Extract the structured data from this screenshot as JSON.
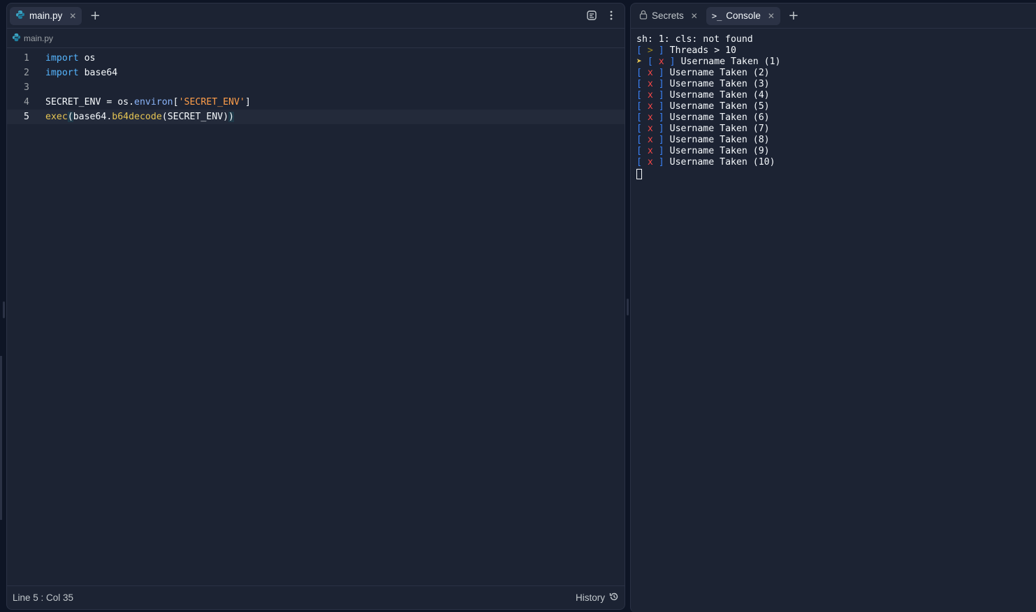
{
  "editor": {
    "tabs": [
      {
        "label": "main.py",
        "icon": "python-icon",
        "active": true
      }
    ],
    "add_tab_label": "+",
    "breadcrumb": "main.py",
    "lines": [
      {
        "n": "1",
        "tokens": [
          {
            "t": "import",
            "c": "kw"
          },
          {
            "t": " os",
            "c": ""
          }
        ]
      },
      {
        "n": "2",
        "tokens": [
          {
            "t": "import",
            "c": "kw"
          },
          {
            "t": " base64",
            "c": ""
          }
        ]
      },
      {
        "n": "3",
        "tokens": []
      },
      {
        "n": "4",
        "tokens": [
          {
            "t": "SECRET_ENV = os.",
            "c": ""
          },
          {
            "t": "environ",
            "c": "attr"
          },
          {
            "t": "[",
            "c": ""
          },
          {
            "t": "'SECRET_ENV'",
            "c": "str"
          },
          {
            "t": "]",
            "c": ""
          }
        ]
      },
      {
        "n": "5",
        "tokens": [
          {
            "t": "exec",
            "c": "fn"
          },
          {
            "t": "(",
            "c": "bm"
          },
          {
            "t": "base64.",
            "c": ""
          },
          {
            "t": "b64decode",
            "c": "fn"
          },
          {
            "t": "(SECRET_ENV)",
            "c": ""
          },
          {
            "t": ")",
            "c": "bm"
          }
        ]
      }
    ],
    "current_line": "5",
    "status": {
      "position": "Line 5 : Col 35",
      "history_label": "History"
    }
  },
  "console": {
    "tabs": [
      {
        "label": "Secrets",
        "icon": "lock-icon",
        "active": false
      },
      {
        "label": "Console",
        "icon": "terminal-icon",
        "active": true
      }
    ],
    "add_tab_label": "+",
    "output": [
      {
        "type": "plain",
        "text": "sh: 1: cls: not found"
      },
      {
        "type": "info",
        "mark": ">",
        "text": "Threads > 10"
      },
      {
        "type": "fail",
        "mark": "x",
        "text": "Username Taken (1)",
        "arrow": true
      },
      {
        "type": "fail",
        "mark": "x",
        "text": "Username Taken (2)"
      },
      {
        "type": "fail",
        "mark": "x",
        "text": "Username Taken (3)"
      },
      {
        "type": "fail",
        "mark": "x",
        "text": "Username Taken (4)"
      },
      {
        "type": "fail",
        "mark": "x",
        "text": "Username Taken (5)"
      },
      {
        "type": "fail",
        "mark": "x",
        "text": "Username Taken (6)"
      },
      {
        "type": "fail",
        "mark": "x",
        "text": "Username Taken (7)"
      },
      {
        "type": "fail",
        "mark": "x",
        "text": "Username Taken (8)"
      },
      {
        "type": "fail",
        "mark": "x",
        "text": "Username Taken (9)"
      },
      {
        "type": "fail",
        "mark": "x",
        "text": "Username Taken (10)"
      }
    ]
  },
  "colors": {
    "bg": "#0e1525",
    "panel": "#1c2333",
    "border": "#2b3245",
    "keyword": "#56b6ff",
    "function": "#e6c553",
    "string": "#ff9e4a",
    "bracket": "#3b82f6",
    "error": "#f44747"
  }
}
